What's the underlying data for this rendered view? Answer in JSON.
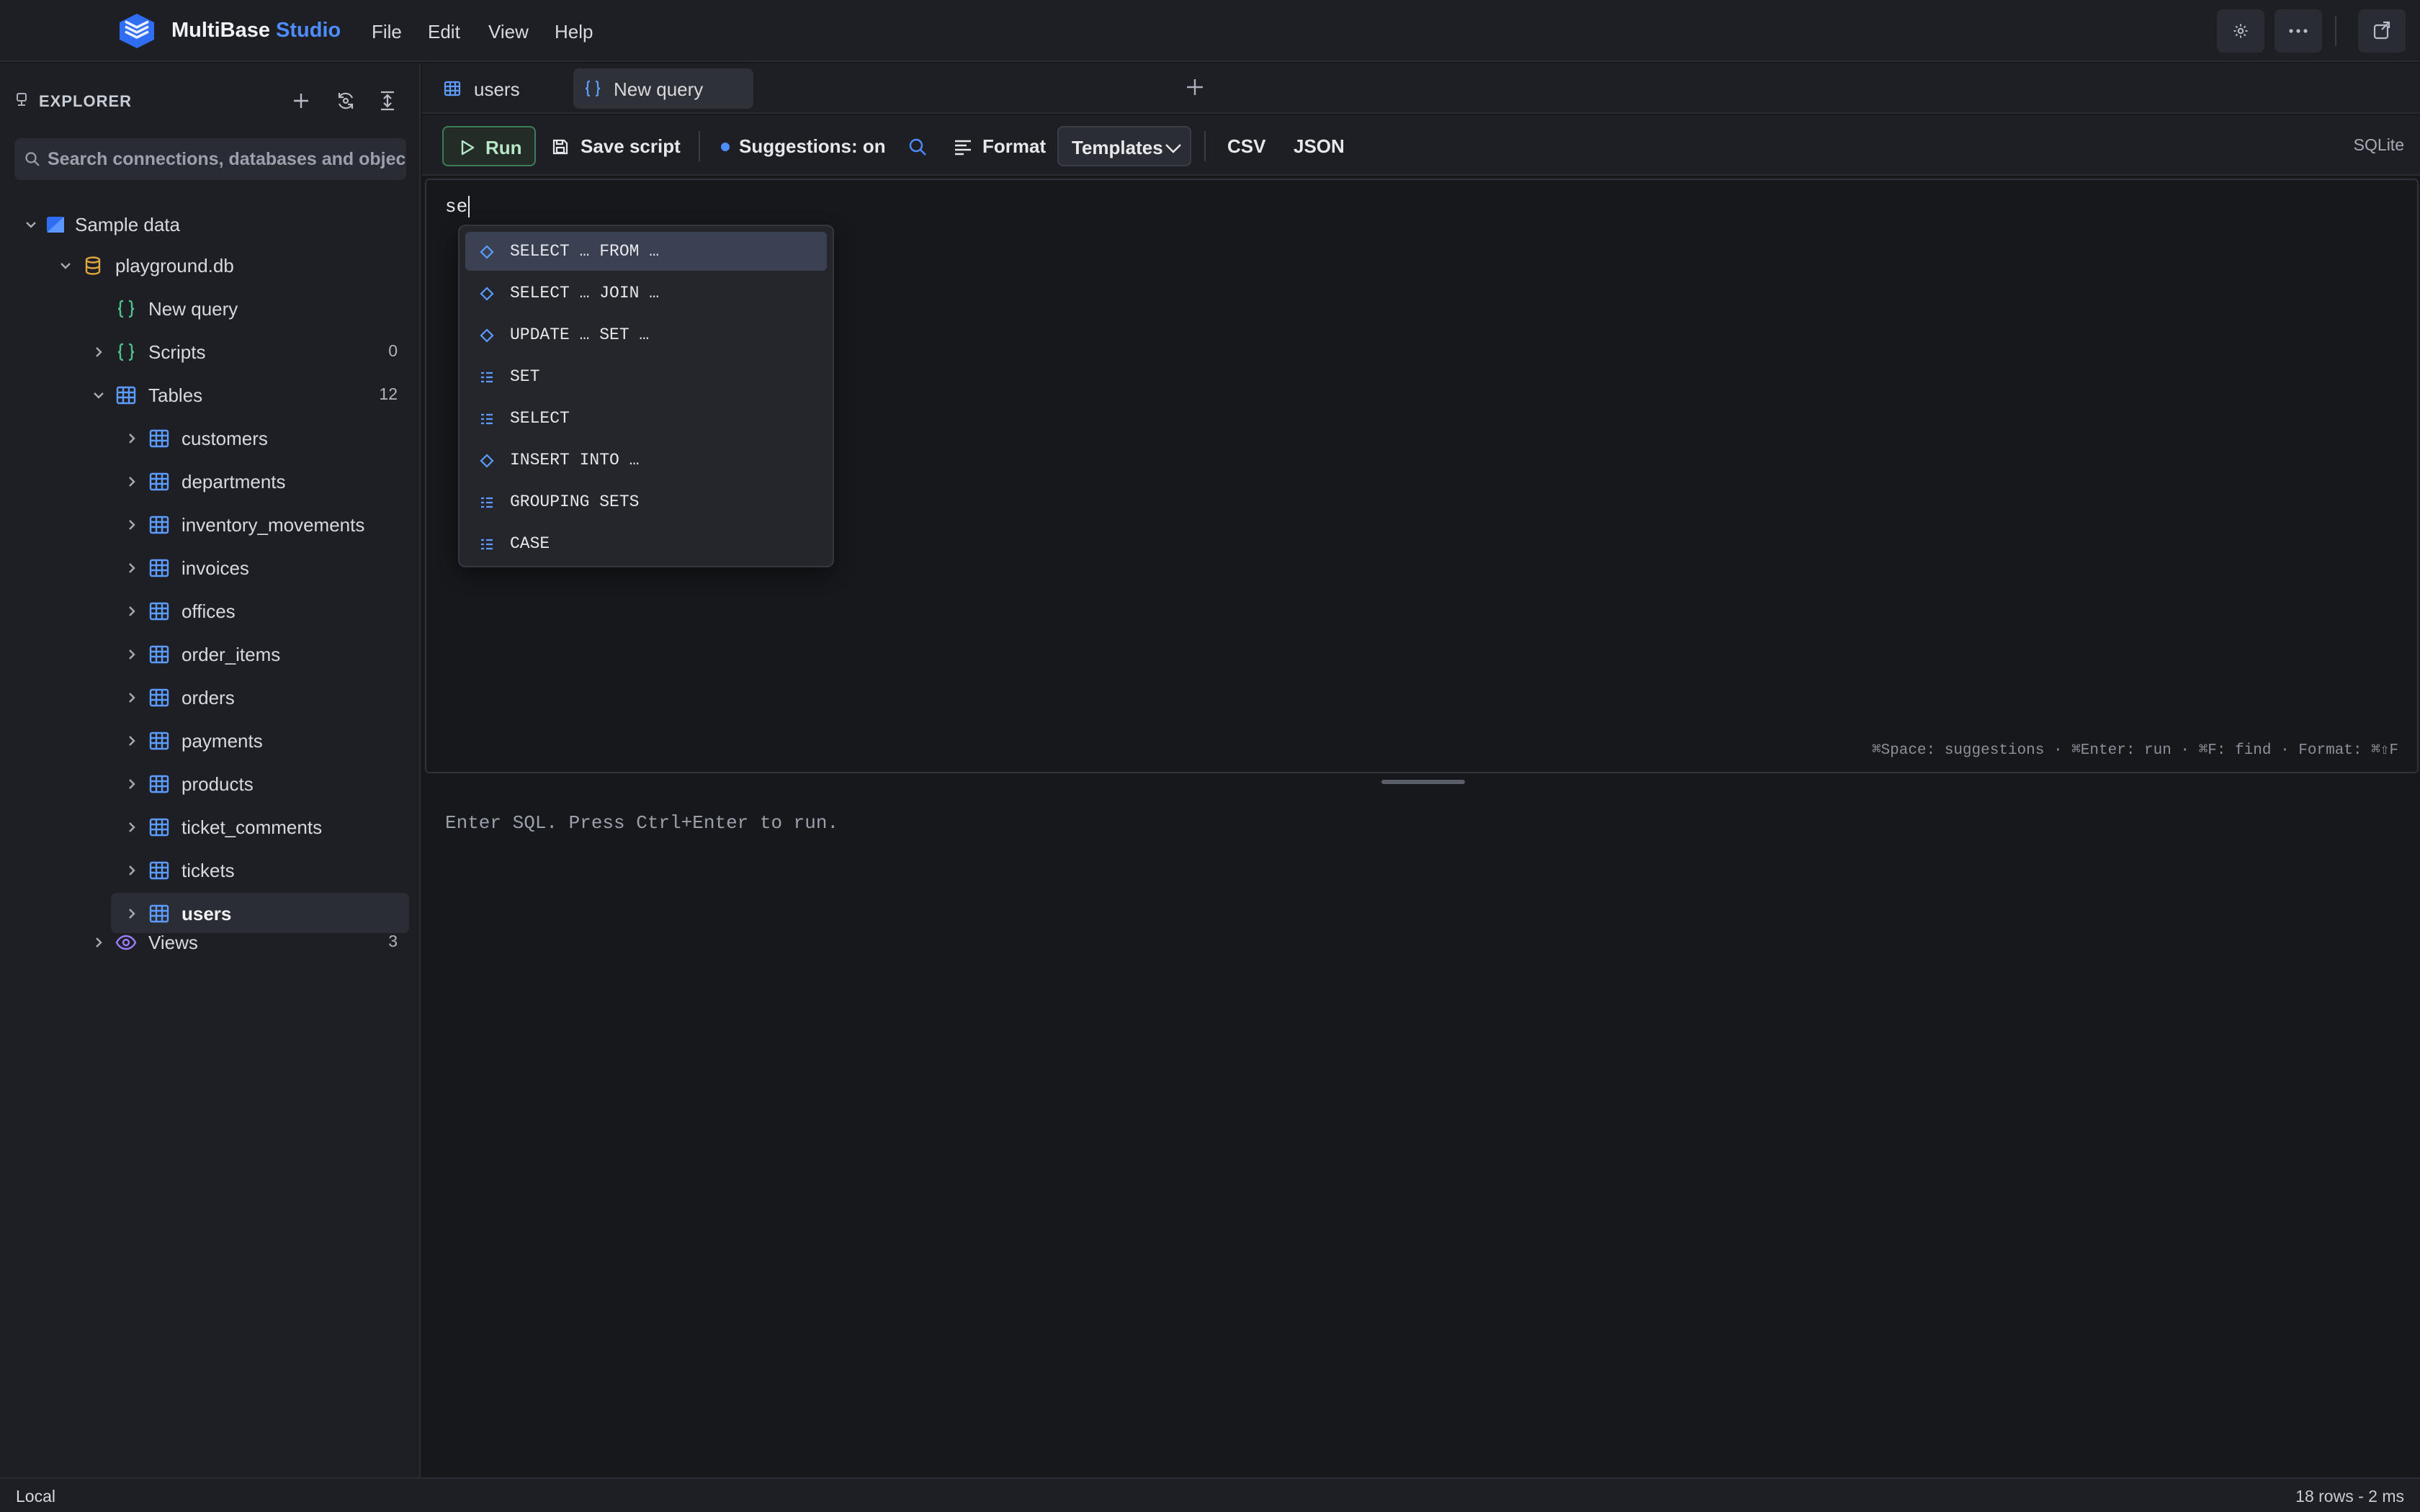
{
  "colors": {
    "accent": "#4d8dff",
    "table_icon": "#5d9cff",
    "db_icon": "#e0a640",
    "script_icon": "#4cc38a",
    "view_icon": "#9b7cff",
    "run_green": "#3b7d58"
  },
  "app": {
    "name": "MultiBase",
    "name_accent": "Studio",
    "logo_icon": "stacked-layers-logo"
  },
  "menu": [
    "File",
    "Edit",
    "View",
    "Help"
  ],
  "titlebar_actions": [
    "gear-icon",
    "more-icon",
    "new-window-icon"
  ],
  "sidebar": {
    "title": "EXPLORER",
    "actions": [
      "plus-icon",
      "refresh-icon",
      "collapse-all-icon"
    ],
    "search_placeholder": "Search connections, databases and objects",
    "tree": {
      "connection": "Sample data",
      "database": "playground.db",
      "new_query": "New query",
      "scripts": {
        "label": "Scripts",
        "count": "0"
      },
      "tables": {
        "label": "Tables",
        "count": "12",
        "items": [
          "customers",
          "departments",
          "inventory_movements",
          "invoices",
          "offices",
          "order_items",
          "orders",
          "payments",
          "products",
          "ticket_comments",
          "tickets",
          "users"
        ],
        "selected": "users"
      },
      "views": {
        "label": "Views",
        "count": "3"
      }
    }
  },
  "tabs": [
    {
      "label": "users",
      "icon": "table-icon",
      "active": false
    },
    {
      "label": "New query",
      "icon": "braces-icon",
      "active": true
    }
  ],
  "toolbar": {
    "run": "Run",
    "save_script": "Save script",
    "suggestions": "Suggestions: on",
    "format": "Format",
    "templates": "Templates",
    "csv": "CSV",
    "json": "JSON",
    "dialect": "SQLite"
  },
  "editor": {
    "text": "se",
    "hints": "⌘Space: suggestions · ⌘Enter: run · ⌘F: find · Format: ⌘⇧F"
  },
  "autocomplete": {
    "items": [
      {
        "label": "SELECT … FROM …",
        "kind": "snippet"
      },
      {
        "label": "SELECT … JOIN …",
        "kind": "snippet"
      },
      {
        "label": "UPDATE … SET …",
        "kind": "snippet"
      },
      {
        "label": "SET",
        "kind": "keyword"
      },
      {
        "label": "SELECT",
        "kind": "keyword"
      },
      {
        "label": "INSERT INTO …",
        "kind": "snippet"
      },
      {
        "label": "GROUPING SETS",
        "kind": "keyword"
      },
      {
        "label": "CASE",
        "kind": "keyword"
      }
    ],
    "active_index": 0
  },
  "results": {
    "message": "Enter SQL. Press Ctrl+Enter to run."
  },
  "status": {
    "left": "Local",
    "right": "18 rows - 2 ms"
  }
}
